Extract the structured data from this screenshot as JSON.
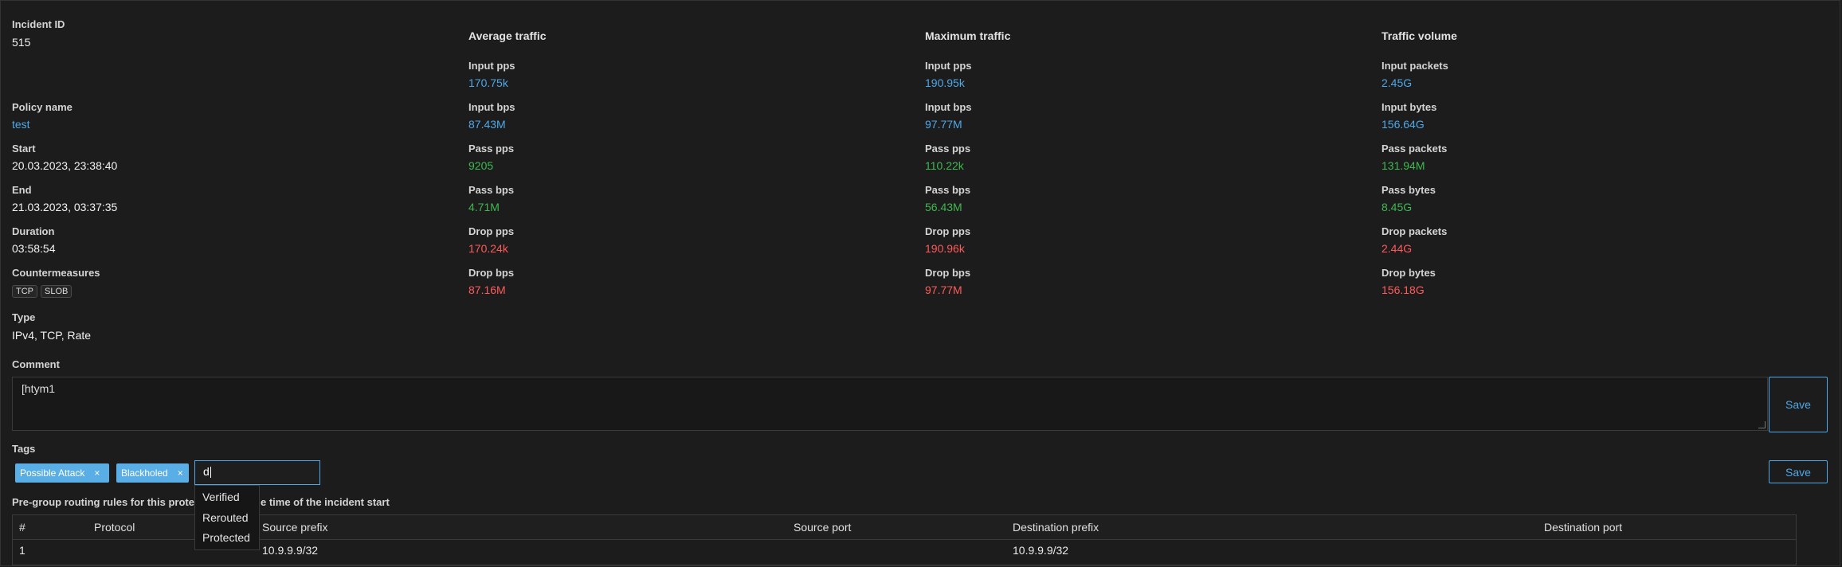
{
  "incident": {
    "id_label": "Incident ID",
    "id_value": "515",
    "policy_label": "Policy name",
    "policy_value": "test",
    "start_label": "Start",
    "start_value": "20.03.2023, 23:38:40",
    "end_label": "End",
    "end_value": "21.03.2023, 03:37:35",
    "duration_label": "Duration",
    "duration_value": "03:58:54",
    "countermeasures_label": "Countermeasures",
    "countermeasures": [
      "TCP",
      "SLOB"
    ],
    "type_label": "Type",
    "type_value": "IPv4, TCP, Rate"
  },
  "average": {
    "title": "Average traffic",
    "rows": [
      {
        "label": "Input pps",
        "value": "170.75k"
      },
      {
        "label": "Input bps",
        "value": "87.43M"
      },
      {
        "label": "Pass pps",
        "value": "9205"
      },
      {
        "label": "Pass bps",
        "value": "4.71M"
      },
      {
        "label": "Drop pps",
        "value": "170.24k"
      },
      {
        "label": "Drop bps",
        "value": "87.16M"
      }
    ]
  },
  "maximum": {
    "title": "Maximum traffic",
    "rows": [
      {
        "label": "Input pps",
        "value": "190.95k"
      },
      {
        "label": "Input bps",
        "value": "97.77M"
      },
      {
        "label": "Pass pps",
        "value": "110.22k"
      },
      {
        "label": "Pass bps",
        "value": "56.43M"
      },
      {
        "label": "Drop pps",
        "value": "190.96k"
      },
      {
        "label": "Drop bps",
        "value": "97.77M"
      }
    ]
  },
  "volume": {
    "title": "Traffic volume",
    "rows": [
      {
        "label": "Input packets",
        "value": "2.45G"
      },
      {
        "label": "Input bytes",
        "value": "156.64G"
      },
      {
        "label": "Pass packets",
        "value": "131.94M"
      },
      {
        "label": "Pass bytes",
        "value": "8.45G"
      },
      {
        "label": "Drop packets",
        "value": "2.44G"
      },
      {
        "label": "Drop bytes",
        "value": "156.18G"
      }
    ]
  },
  "comment": {
    "label": "Comment",
    "value": "[htym1",
    "save_label": "Save"
  },
  "tags": {
    "label": "Tags",
    "items": [
      "Possible Attack",
      "Blackholed"
    ],
    "remove_glyph": "×",
    "input_value": "d",
    "save_label": "Save",
    "suggestions": [
      "Verified",
      "Rerouted",
      "Protected"
    ]
  },
  "routing": {
    "caption_left": "Pre-group routing rules for this protectio",
    "caption_right": "e time of the incident start",
    "columns": [
      "#",
      "Protocol",
      "Source prefix",
      "Source port",
      "Destination prefix",
      "Destination port"
    ],
    "rows": [
      {
        "num": "1",
        "protocol": "",
        "source_prefix": "10.9.9.9/32",
        "source_port": "",
        "destination_prefix": "10.9.9.9/32",
        "destination_port": ""
      }
    ]
  },
  "colors": {
    "background": "#1c1c1c",
    "accent": "#4fa8e8",
    "pass": "#3fb950",
    "drop": "#ff5a5a"
  }
}
